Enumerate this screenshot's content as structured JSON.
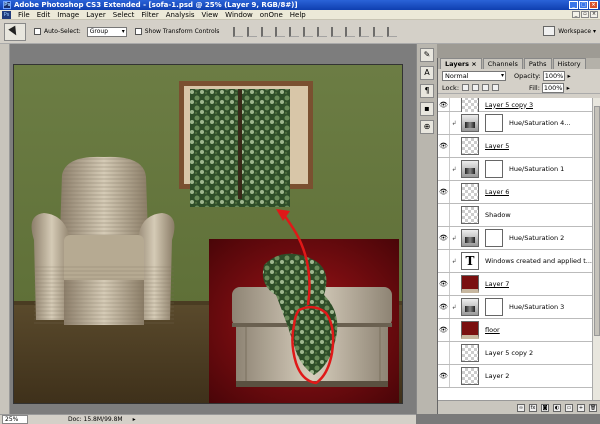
{
  "window": {
    "title": "Adobe Photoshop CS3 Extended - [sofa-1.psd @ 25% (Layer 9, RGB/8#)]",
    "controls": [
      "_",
      "□",
      "×"
    ]
  },
  "menu": {
    "items": [
      "File",
      "Edit",
      "Image",
      "Layer",
      "Select",
      "Filter",
      "Analysis",
      "View",
      "Window",
      "onOne",
      "Help"
    ]
  },
  "options": {
    "auto_select_label": "Auto-Select:",
    "auto_select_value": "Group",
    "transform_label": "Show Transform Controls",
    "workspace_label": "Workspace ▾"
  },
  "status": {
    "zoom": "25%",
    "doc": "Doc: 15.8M/99.8M"
  },
  "layers_panel": {
    "tabs": [
      "Layers ×",
      "Channels",
      "Paths",
      "History"
    ],
    "blend_mode": "Normal",
    "opacity_label": "Opacity:",
    "opacity_value": "100%",
    "lock_label": "Lock:",
    "fill_label": "Fill:",
    "fill_value": "100%",
    "layers": [
      {
        "name": "Layer 5 copy 3",
        "visible": true,
        "thumb": "checker",
        "underline": true
      },
      {
        "name": "Hue/Saturation 4...",
        "visible": false,
        "thumb": "adj",
        "linked": true
      },
      {
        "name": "Layer 5",
        "visible": true,
        "thumb": "checker",
        "underline": true
      },
      {
        "name": "Hue/Saturation 1",
        "visible": false,
        "thumb": "adj",
        "linked": true
      },
      {
        "name": "Layer 6",
        "visible": true,
        "thumb": "checker",
        "underline": true
      },
      {
        "name": "Shadow",
        "visible": false,
        "thumb": "checker"
      },
      {
        "name": "Hue/Saturation 2",
        "visible": true,
        "thumb": "adj",
        "linked": true
      },
      {
        "name": "Windows created and applied t...",
        "visible": false,
        "thumb": "text",
        "linked": true
      },
      {
        "name": "Layer 7",
        "visible": true,
        "thumb": "red",
        "underline": true
      },
      {
        "name": "Hue/Saturation 3",
        "visible": true,
        "thumb": "adj",
        "linked": true
      },
      {
        "name": "floor",
        "visible": true,
        "thumb": "red",
        "underline": true
      },
      {
        "name": "Layer 5 copy 2",
        "visible": false,
        "thumb": "checker"
      },
      {
        "name": "Layer 2",
        "visible": true,
        "thumb": "checker"
      }
    ]
  },
  "colors": {
    "title_bar": "#1a4fc4",
    "wall": "#6e7f45",
    "floor": "#5b4a2d",
    "overlay_red": "#7c0e12",
    "arrow": "#e01818"
  }
}
